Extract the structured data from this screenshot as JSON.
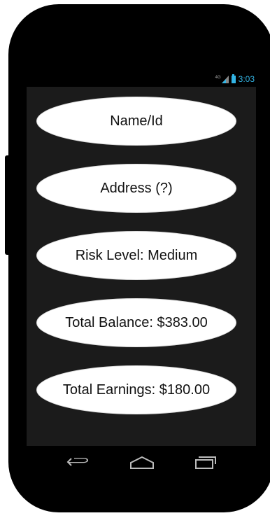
{
  "status_bar": {
    "network": "4G",
    "time": "3:03"
  },
  "fields": [
    {
      "label": "Name/Id"
    },
    {
      "label": "Address (?)"
    },
    {
      "label": "Risk Level: Medium"
    },
    {
      "label": "Total Balance: $383.00"
    },
    {
      "label": "Total Earnings: $180.00"
    }
  ],
  "nav": {
    "back_icon": "back-icon",
    "home_icon": "home-icon",
    "recents_icon": "recents-icon"
  },
  "colors": {
    "accent": "#33b5e5",
    "screen_bg": "#1b1b1b",
    "device": "#000000"
  }
}
